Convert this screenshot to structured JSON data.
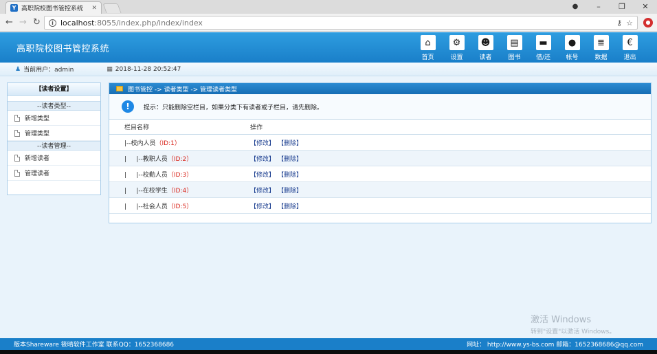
{
  "browser": {
    "tab_title": "高职院校图书管控系统",
    "tab_favicon": "Y",
    "url_host": "localhost",
    "url_rest": ":8055/index.php/index/index"
  },
  "app": {
    "title": "高职院校图书管控系统",
    "nav": [
      {
        "label": "首页",
        "icon": "home-icon",
        "glyph": "⌂"
      },
      {
        "label": "设置",
        "icon": "gears-icon",
        "glyph": "⚙"
      },
      {
        "label": "读者",
        "icon": "users-icon",
        "glyph": "☻"
      },
      {
        "label": "图书",
        "icon": "book-icon",
        "glyph": "▤"
      },
      {
        "label": "借/还",
        "icon": "folder-icon",
        "glyph": "▬"
      },
      {
        "label": "帐号",
        "icon": "user-icon",
        "glyph": "●"
      },
      {
        "label": "数据",
        "icon": "database-icon",
        "glyph": "≣"
      },
      {
        "label": "退出",
        "icon": "euro-icon",
        "glyph": "€"
      }
    ]
  },
  "userbar": {
    "current_user": "当前用户：admin",
    "datetime": "2018-11-28 20:52:47"
  },
  "sidebar": {
    "title": "【读者设置】",
    "groups": [
      {
        "label": "--读者类型--",
        "items": [
          "新增类型",
          "管理类型"
        ]
      },
      {
        "label": "--读者管理--",
        "items": [
          "新增读者",
          "管理读者"
        ]
      }
    ]
  },
  "main": {
    "breadcrumb": "图书管控 -> 读者类型 -> 管理读者类型",
    "tip": "提示：只能删除空栏目，如果分类下有读者或子栏目，请先删除。",
    "columns": {
      "name": "栏目名称",
      "ops": "操作"
    },
    "edit_label": "【修改】",
    "delete_label": "【删除】",
    "rows": [
      {
        "prefix": "|--校内人员",
        "id": "（ID:1）"
      },
      {
        "prefix": "|     |--教职人员",
        "id": "（ID:2）"
      },
      {
        "prefix": "|     |--校勤人员",
        "id": "（ID:3）"
      },
      {
        "prefix": "|     |--在校学生",
        "id": "（ID:4）"
      },
      {
        "prefix": "|     |--社会人员",
        "id": "（ID:5）"
      }
    ]
  },
  "watermark": {
    "title": "激活 Windows",
    "subtitle": "转到\"设置\"以激活 Windows。"
  },
  "footer": {
    "left": "版本Shareware  筱晴软件工作室  联系QQ：1652368686",
    "right": "网址：  http://www.ys-bs.com  邮箱：1652368686@qq.com"
  }
}
